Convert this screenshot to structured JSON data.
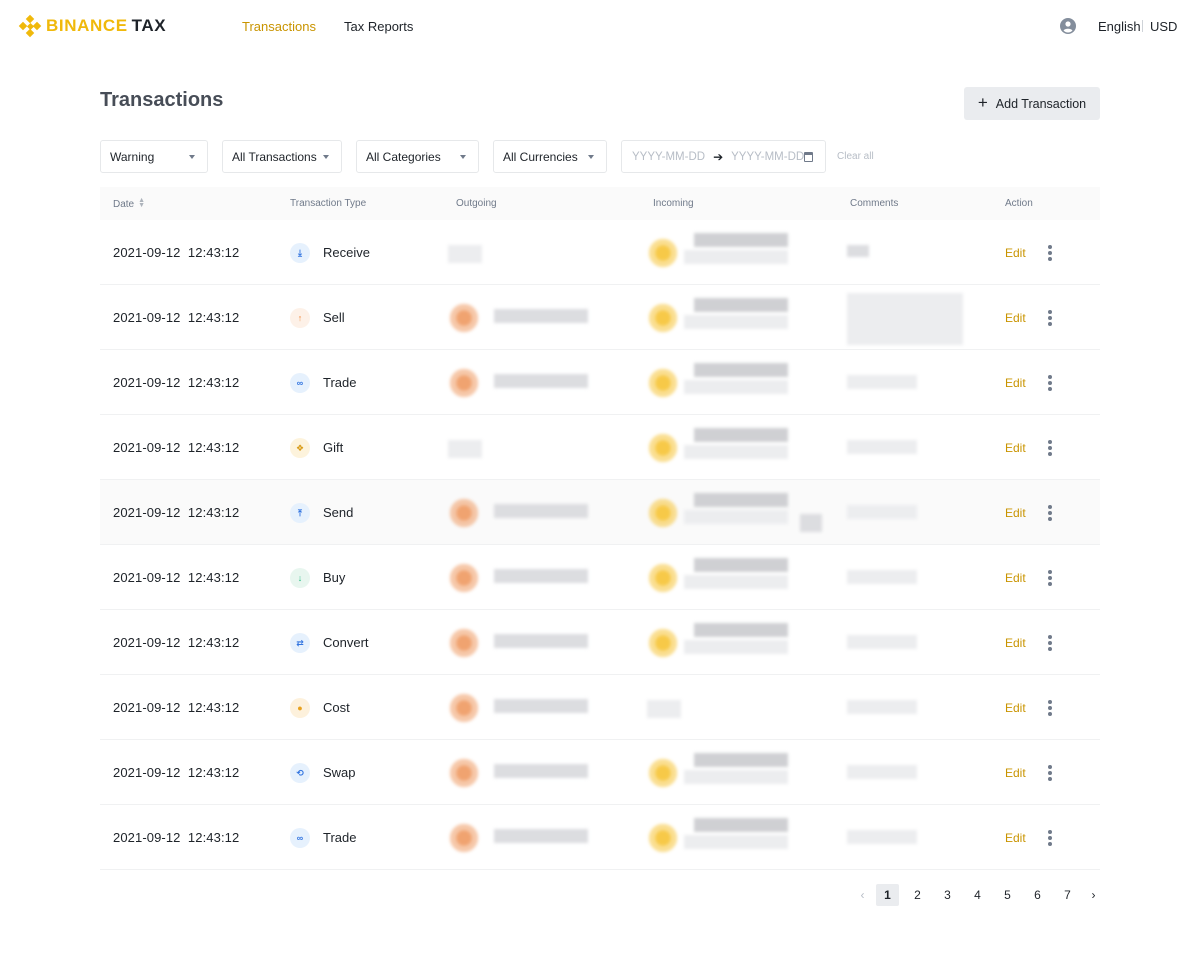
{
  "brand": {
    "name": "BINANCE",
    "suffix": "TAX",
    "color": "#f0b90b"
  },
  "nav": {
    "items": [
      {
        "label": "Transactions",
        "active": true
      },
      {
        "label": "Tax Reports",
        "active": false
      }
    ],
    "language": "English",
    "currency": "USD",
    "user_icon": "user-circle-icon"
  },
  "page": {
    "title": "Transactions",
    "add_button": "Add Transaction"
  },
  "filters": {
    "status": "Warning",
    "transactions": "All Transactions",
    "categories": "All Categories",
    "currencies": "All Currencies",
    "date_from_placeholder": "YYYY-MM-DD",
    "date_to_placeholder": "YYYY-MM-DD",
    "clear_all": "Clear all"
  },
  "table": {
    "columns": {
      "date": "Date",
      "type": "Transaction Type",
      "outgoing": "Outgoing",
      "incoming": "Incoming",
      "comments": "Comments",
      "action": "Action"
    },
    "edit_label": "Edit",
    "rows": [
      {
        "date": "2021-09-12  12:43:12",
        "type": "Receive",
        "icon": "receive-icon"
      },
      {
        "date": "2021-09-12  12:43:12",
        "type": "Sell",
        "icon": "arrow-up-icon"
      },
      {
        "date": "2021-09-12  12:43:12",
        "type": "Trade",
        "icon": "link-icon"
      },
      {
        "date": "2021-09-12  12:43:12",
        "type": "Gift",
        "icon": "gift-icon"
      },
      {
        "date": "2021-09-12  12:43:12",
        "type": "Send",
        "icon": "send-icon"
      },
      {
        "date": "2021-09-12  12:43:12",
        "type": "Buy",
        "icon": "arrow-down-icon"
      },
      {
        "date": "2021-09-12  12:43:12",
        "type": "Convert",
        "icon": "convert-icon"
      },
      {
        "date": "2021-09-12  12:43:12",
        "type": "Cost",
        "icon": "cost-icon"
      },
      {
        "date": "2021-09-12  12:43:12",
        "type": "Swap",
        "icon": "swap-icon"
      },
      {
        "date": "2021-09-12  12:43:12",
        "type": "Trade",
        "icon": "link-icon"
      }
    ]
  },
  "pagination": {
    "pages": [
      "1",
      "2",
      "3",
      "4",
      "5",
      "6",
      "7"
    ],
    "current": "1",
    "prev": "‹",
    "next": "›"
  },
  "colors": {
    "accent": "#c99400",
    "text": "#1e2329",
    "muted": "#707a8a"
  }
}
